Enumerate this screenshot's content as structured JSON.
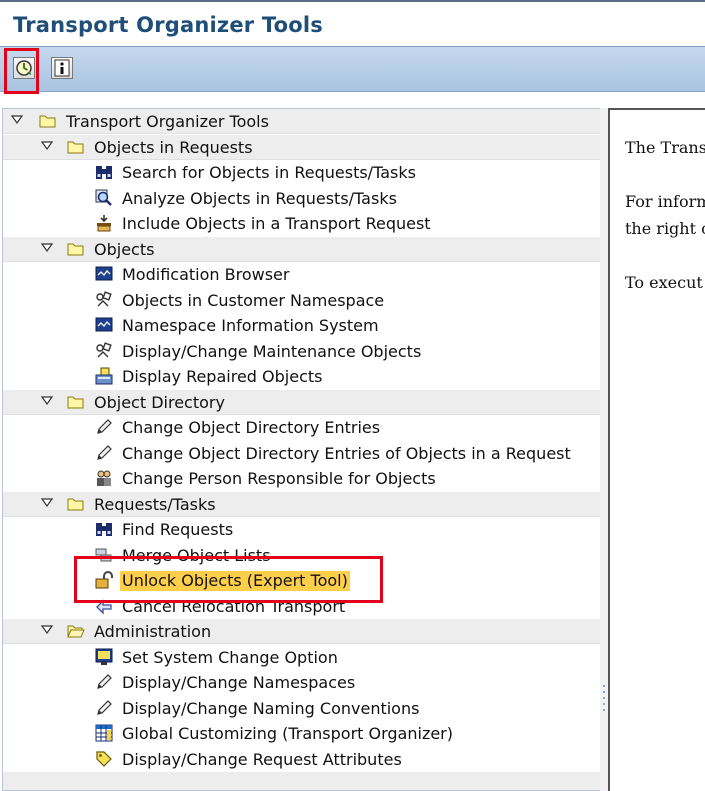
{
  "window": {
    "title": "Transport Organizer Tools"
  },
  "toolbar": {
    "buttons": [
      {
        "name": "execute",
        "icon": "clock-execute-icon"
      },
      {
        "name": "information",
        "icon": "info-icon"
      }
    ]
  },
  "tree": {
    "root": {
      "label": "Transport Organizer Tools",
      "expanded": true
    },
    "folders": [
      {
        "label": "Objects in Requests",
        "items": [
          {
            "label": "Search for Objects in Requests/Tasks",
            "icon": "binoculars-icon"
          },
          {
            "label": "Analyze Objects in Requests/Tasks",
            "icon": "magnifier-icon"
          },
          {
            "label": "Include Objects in a Transport Request",
            "icon": "include-icon"
          }
        ]
      },
      {
        "label": "Objects",
        "items": [
          {
            "label": "Modification Browser",
            "icon": "monitor-icon"
          },
          {
            "label": "Objects in Customer Namespace",
            "icon": "objects-icon"
          },
          {
            "label": "Namespace Information System",
            "icon": "monitor-icon"
          },
          {
            "label": "Display/Change Maintenance Objects",
            "icon": "objects-icon"
          },
          {
            "label": "Display Repaired Objects",
            "icon": "repaired-objects-icon"
          }
        ]
      },
      {
        "label": "Object Directory",
        "items": [
          {
            "label": "Change Object Directory Entries",
            "icon": "pencil-icon"
          },
          {
            "label": "Change Object Directory Entries of Objects in a Request",
            "icon": "pencil-icon"
          },
          {
            "label": "Change Person Responsible for Objects",
            "icon": "persons-icon"
          }
        ]
      },
      {
        "label": "Requests/Tasks",
        "items": [
          {
            "label": "Find Requests",
            "icon": "binoculars-icon"
          },
          {
            "label": "Merge Object Lists",
            "icon": "merge-icon"
          },
          {
            "label": "Unlock Objects (Expert Tool)",
            "icon": "unlock-icon",
            "selected": true
          },
          {
            "label": "Cancel Relocation Transport",
            "icon": "cancel-relocation-icon"
          }
        ]
      },
      {
        "label": "Administration",
        "items": [
          {
            "label": "Set System Change Option",
            "icon": "system-change-icon"
          },
          {
            "label": "Display/Change Namespaces",
            "icon": "pencil-icon"
          },
          {
            "label": "Display/Change Naming Conventions",
            "icon": "pencil-icon"
          },
          {
            "label": "Global Customizing (Transport Organizer)",
            "icon": "table-icon"
          },
          {
            "label": "Display/Change Request Attributes",
            "icon": "tag-icon"
          }
        ]
      }
    ]
  },
  "description": {
    "lines": [
      "The Trans",
      "For inform",
      "the right c",
      "To execut"
    ]
  },
  "colors": {
    "highlight_box": "#e3001b",
    "selected_item": "#ffcf4a",
    "title_text": "#1f4e79",
    "toolbar": "#b8cfe8"
  }
}
